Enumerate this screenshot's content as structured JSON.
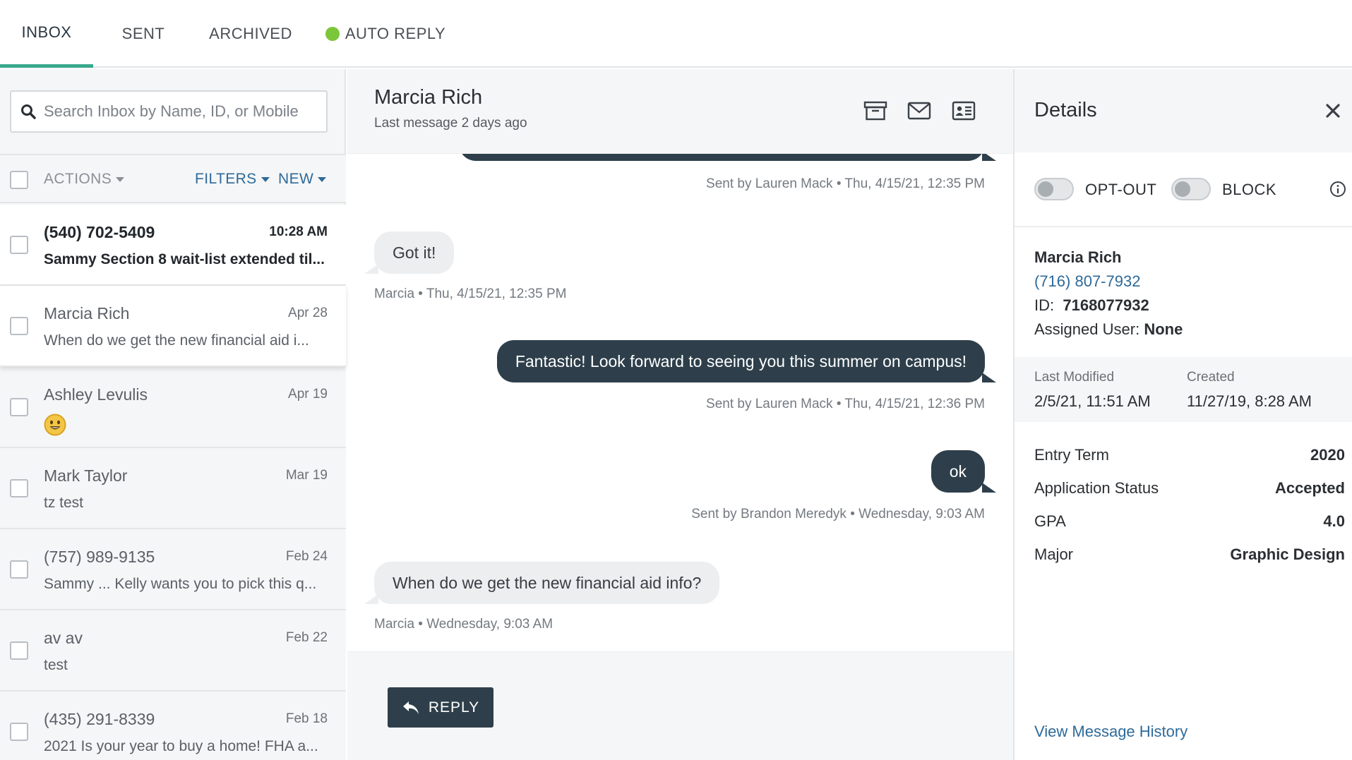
{
  "tabs": [
    {
      "label": "INBOX"
    },
    {
      "label": "SENT"
    },
    {
      "label": "ARCHIVED"
    },
    {
      "label": "AUTO REPLY"
    }
  ],
  "search": {
    "placeholder": "Search Inbox by Name, ID, or Mobile"
  },
  "listbar": {
    "actions": "ACTIONS",
    "filters": "FILTERS",
    "new": "NEW"
  },
  "conversations": [
    {
      "name": "(540) 702-5409",
      "time": "10:28 AM",
      "preview": "Sammy Section 8 wait-list extended til..."
    },
    {
      "name": "Marcia Rich",
      "time": "Apr 28",
      "preview": "When do we get the new financial aid i..."
    },
    {
      "name": "Ashley Levulis",
      "time": "Apr 19",
      "preview": ""
    },
    {
      "name": "Mark Taylor",
      "time": "Mar 19",
      "preview": "tz test"
    },
    {
      "name": "(757) 989-9135",
      "time": "Feb 24",
      "preview": "Sammy ... Kelly wants you to pick this q..."
    },
    {
      "name": "av av",
      "time": "Feb 22",
      "preview": "test"
    },
    {
      "name": "(435) 291-8339",
      "time": "Feb 18",
      "preview": "2021 Is your year to buy a home! FHA a..."
    }
  ],
  "thread": {
    "contact_name": "Marcia Rich",
    "last_message": "Last message 2 days ago",
    "messages": [
      {
        "meta": "Sent by Lauren Mack • Thu, 4/15/21, 12:35 PM"
      },
      {
        "text": "Got it!",
        "meta": "Marcia • Thu, 4/15/21, 12:35 PM"
      },
      {
        "text": "Fantastic! Look forward to seeing you this summer on campus!",
        "meta": "Sent by Lauren Mack • Thu, 4/15/21, 12:36 PM"
      },
      {
        "text": "ok",
        "meta": "Sent by Brandon Meredyk • Wednesday, 9:03 AM"
      },
      {
        "text": "When do we get the new financial aid info?",
        "meta": "Marcia • Wednesday, 9:03 AM"
      }
    ],
    "reply_label": "REPLY"
  },
  "details": {
    "title": "Details",
    "optout_label": "OPT-OUT",
    "block_label": "BLOCK",
    "name": "Marcia Rich",
    "phone": "(716) 807-7932",
    "id_label": "ID:",
    "id_value": "7168077932",
    "assigned_label": "Assigned User:",
    "assigned_value": "None",
    "last_modified_label": "Last Modified",
    "last_modified_value": "2/5/21, 11:51 AM",
    "created_label": "Created",
    "created_value": "11/27/19, 8:28 AM",
    "attributes": [
      {
        "label": "Entry Term",
        "value": "2020"
      },
      {
        "label": "Application Status",
        "value": "Accepted"
      },
      {
        "label": "GPA",
        "value": "4.0"
      },
      {
        "label": "Major",
        "value": "Graphic Design"
      }
    ],
    "history_link": "View Message History"
  },
  "colors": {
    "accent": "#3aa78e",
    "bubble_out": "#2e3f4b",
    "link": "#2e6a99",
    "auto_reply_dot": "#7cc63a"
  }
}
